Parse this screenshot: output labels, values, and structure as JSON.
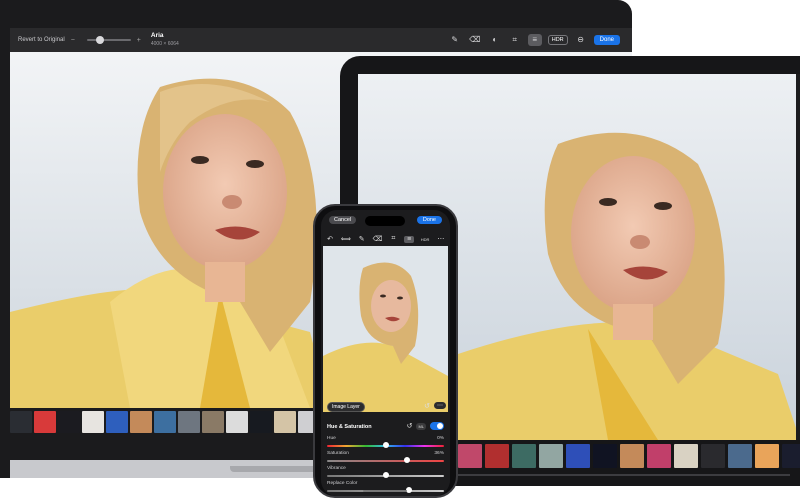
{
  "mac": {
    "revert_label": "Revert to Original",
    "minus": "−",
    "plus": "+",
    "title": "Aria",
    "dimensions": "4000 × 6064",
    "hdr_label": "HDR",
    "done_label": "Done",
    "zoom_level": 0.3,
    "filmstrip_colors": [
      "#2a2d33",
      "#d83a3a",
      "#1b1b20",
      "#e7e4e0",
      "#2e5fbd",
      "#c48a5a",
      "#3d6fa0",
      "#6e7680",
      "#8a7a66",
      "#dcdcdc",
      "#171a20",
      "#d4c4a6",
      "#cfcfd2",
      "#e3e3e3",
      "#c7d1dd"
    ]
  },
  "ipad": {
    "filmstrip_colors": [
      "#c0486a",
      "#b12f2f",
      "#3d6b63",
      "#92a6a2",
      "#2e4fb8",
      "#101322",
      "#c48a5a",
      "#c13f6a",
      "#d9d2c3",
      "#2a2a2e",
      "#4b6a8d",
      "#e9a45a",
      "#1a1d2e",
      "#7a8c99",
      "#505a66"
    ],
    "scrub_position": 0.3
  },
  "iphone": {
    "cancel_label": "Cancel",
    "done_label": "Done",
    "tools": [
      "↶",
      "⟺",
      "✎",
      "⌫",
      "⌗",
      "≡",
      "HDR",
      "⋯"
    ],
    "image_layer_label": "Image Layer",
    "panel_title": "Hue & Saturation",
    "ml_label": "ML",
    "more_label": "⋯",
    "rows": [
      {
        "label": "Hue",
        "value": "0%",
        "position": 0.5
      },
      {
        "label": "Saturation",
        "value": "36%",
        "position": 0.68
      },
      {
        "label": "Vibrance",
        "value": "",
        "position": 0.5
      },
      {
        "label": "Replace Color",
        "value": "",
        "position": 0.7
      }
    ]
  }
}
